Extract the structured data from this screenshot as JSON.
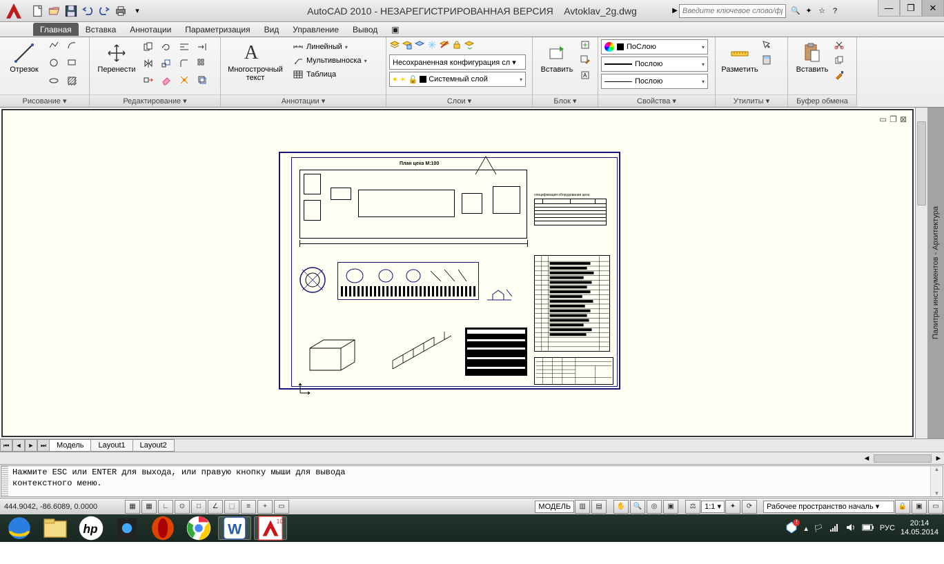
{
  "title": {
    "app": "AutoCAD 2010 - НЕЗАРЕГИСТРИРОВАННАЯ ВЕРСИЯ",
    "file": "Avtoklav_2g.dwg"
  },
  "search": {
    "placeholder": "Введите ключевое слово/фразу"
  },
  "menu": {
    "tabs": [
      "Главная",
      "Вставка",
      "Аннотации",
      "Параметризация",
      "Вид",
      "Управление",
      "Вывод"
    ]
  },
  "ribbon": {
    "draw": {
      "label": "Отрезок",
      "title": "Рисование ▾"
    },
    "modify": {
      "label": "Перенести",
      "title": "Редактирование ▾"
    },
    "anno": {
      "text": "Многострочный текст",
      "linear": "Линейный",
      "mleader": "Мультивыноска",
      "table": "Таблица",
      "title": "Аннотации ▾"
    },
    "layers": {
      "unsaved": "Несохраненная конфигурация сл ▾",
      "current": "Системный слой",
      "title": "Слои ▾"
    },
    "block": {
      "insert": "Вставить",
      "title": "Блок ▾"
    },
    "props": {
      "bylayer": "ПоСлою",
      "line1": "Послою",
      "line2": "Послою",
      "title": "Свойства ▾"
    },
    "utils": {
      "measure": "Разметить",
      "title": "Утилиты ▾"
    },
    "clip": {
      "paste": "Вставить",
      "title": "Буфер обмена"
    }
  },
  "layouts": {
    "model": "Модель",
    "l1": "Layout1",
    "l2": "Layout2"
  },
  "hscroll": {
    "left": "◄",
    "right": "►"
  },
  "command": {
    "line1": "Нажмите ESC или ENTER для выхода, или правую кнопку мыши для вывода",
    "line2": "контекстного меню."
  },
  "status": {
    "coords": "444.9042, -86.6089, 0.0000",
    "model": "МОДЕЛЬ",
    "scale": "1:1 ▾",
    "workspace": "Рабочее пространство началь ▾"
  },
  "sidepanel": "Палитры инструментов - Архитектура",
  "tray": {
    "lang": "РУС",
    "time": "20:14",
    "date": "14.05.2014"
  },
  "drawing": {
    "plan_title": "План цеха М:100"
  }
}
